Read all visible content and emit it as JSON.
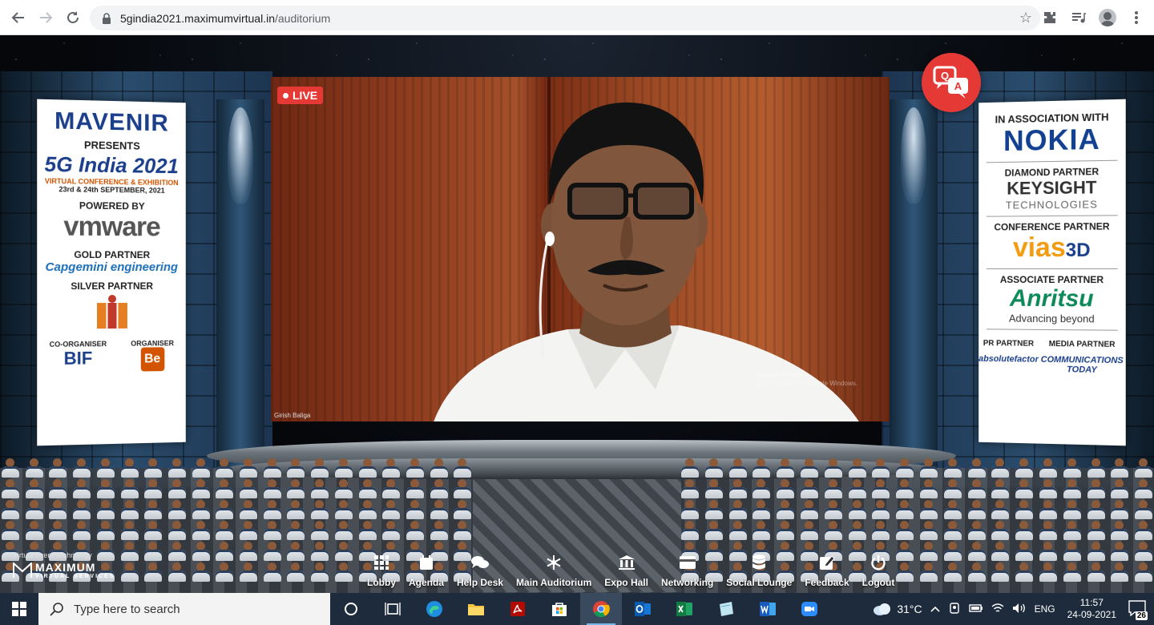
{
  "browser": {
    "url_host": "5gindia2021.maximumvirtual.in",
    "url_path": "/auditorium"
  },
  "video": {
    "live_label": "LIVE",
    "speaker_name": "Girish Baliga",
    "watermark_line1": "Activate Windows",
    "watermark_line2": "Go to Settings to activate Windows."
  },
  "left_banner": {
    "brand": "MAVENIR",
    "presents": "PRESENTS",
    "event_title": "5G India 2021",
    "event_subtitle": "VIRTUAL CONFERENCE & EXHIBITION",
    "event_dates": "23rd & 24th SEPTEMBER, 2021",
    "powered_by": "POWERED BY",
    "vmware": "vmware",
    "gold_partner": "GOLD PARTNER",
    "gold_partner_name": "Capgemini engineering",
    "silver_partner": "SILVER PARTNER",
    "co_organiser": "CO-ORGANISER",
    "co_organiser_name": "BIF",
    "organiser": "ORGANISER",
    "organiser_name": "Be"
  },
  "right_banner": {
    "association": "IN ASSOCIATION WITH",
    "association_name": "NOKIA",
    "diamond_partner": "DIAMOND PARTNER",
    "diamond_partner_name": "KEYSIGHT",
    "diamond_partner_sub": "TECHNOLOGIES",
    "conference_partner": "CONFERENCE PARTNER",
    "conference_partner_name": "vias",
    "conference_partner_suffix": "3D",
    "associate_partner": "ASSOCIATE PARTNER",
    "associate_partner_name": "Anritsu",
    "associate_partner_tagline": "Advancing beyond",
    "pr_partner": "PR PARTNER",
    "pr_partner_name": "absolutefactor",
    "media_partner": "MEDIA PARTNER",
    "media_partner_name": "COMMUNICATIONS TODAY"
  },
  "platform": {
    "tagline": "Virtual Event Technology",
    "brand": "MAXIMUM",
    "brand_sub": "VIRTUAL SERVICES"
  },
  "nav": {
    "items": [
      {
        "label": "Lobby",
        "icon": "grid-icon"
      },
      {
        "label": "Agenda",
        "icon": "calendar-icon"
      },
      {
        "label": "Help Desk",
        "icon": "chat-icon"
      },
      {
        "label": "Main Auditorium",
        "icon": "snowflake-icon"
      },
      {
        "label": "Expo Hall",
        "icon": "building-icon"
      },
      {
        "label": "Networking",
        "icon": "card-icon"
      },
      {
        "label": "Social Lounge",
        "icon": "database-icon"
      },
      {
        "label": "Feedback",
        "icon": "edit-icon"
      },
      {
        "label": "Logout",
        "icon": "power-icon"
      }
    ]
  },
  "taskbar": {
    "search_placeholder": "Type here to search",
    "temperature": "31°C",
    "language": "ENG",
    "time": "11:57",
    "date": "24-09-2021",
    "notifications": "26"
  }
}
